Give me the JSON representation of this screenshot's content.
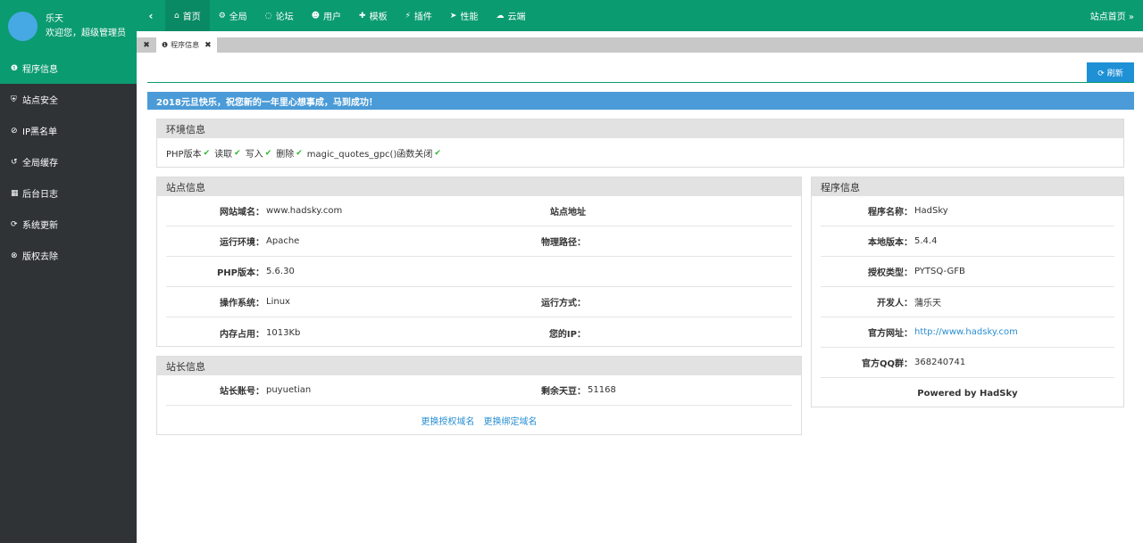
{
  "user": {
    "name": "乐天",
    "greeting": "欢迎您，超级管理员"
  },
  "sidebar": {
    "items": [
      {
        "icon": "info-circle-icon",
        "glyph": "❶",
        "label": "程序信息"
      },
      {
        "icon": "shield-icon",
        "glyph": "⛨",
        "label": "站点安全"
      },
      {
        "icon": "ban-icon",
        "glyph": "⊘",
        "label": "IP黑名单"
      },
      {
        "icon": "history-icon",
        "glyph": "↺",
        "label": "全局缓存"
      },
      {
        "icon": "calendar-icon",
        "glyph": "▦",
        "label": "后台日志"
      },
      {
        "icon": "refresh-icon",
        "glyph": "⟳",
        "label": "系统更新"
      },
      {
        "icon": "times-circle-icon",
        "glyph": "⊗",
        "label": "版权去除"
      }
    ]
  },
  "topnav": {
    "back_glyph": "‹",
    "items": [
      {
        "icon": "home-icon",
        "glyph": "⌂",
        "label": "首页"
      },
      {
        "icon": "cogs-icon",
        "glyph": "⚙",
        "label": "全局"
      },
      {
        "icon": "comments-icon",
        "glyph": "◌",
        "label": "论坛"
      },
      {
        "icon": "users-icon",
        "glyph": "☻",
        "label": "用户"
      },
      {
        "icon": "puzzle-icon",
        "glyph": "✚",
        "label": "模板"
      },
      {
        "icon": "plug-icon",
        "glyph": "⚡",
        "label": "插件"
      },
      {
        "icon": "send-icon",
        "glyph": "➤",
        "label": "性能"
      },
      {
        "icon": "cloud-icon",
        "glyph": "☁",
        "label": "云端"
      }
    ],
    "right_label": "站点首页 »"
  },
  "tabs": {
    "close_all": "✖",
    "active_tab": {
      "icon": "❶",
      "label": "程序信息",
      "close": "✖"
    }
  },
  "toolbar": {
    "refresh_label": "⟳ 刷新"
  },
  "notice": "2018元旦快乐，祝您新的一年里心想事成，马到成功！",
  "env": {
    "title": "环境信息",
    "items": [
      {
        "label": "PHP版本",
        "check": "✔"
      },
      {
        "label": "读取",
        "check": "✔"
      },
      {
        "label": "写入",
        "check": "✔"
      },
      {
        "label": "删除",
        "check": "✔"
      },
      {
        "label": "magic_quotes_gpc()函数关闭",
        "check": "✔"
      }
    ]
  },
  "site": {
    "title": "站点信息",
    "rows": [
      {
        "l1": "网站域名：",
        "v1": "www.hadsky.com",
        "l2": "站点地址",
        "v2": ""
      },
      {
        "l1": "运行环境：",
        "v1": "Apache",
        "l2": "物理路径：",
        "v2": ""
      },
      {
        "l1": "PHP版本：",
        "v1": "5.6.30",
        "l2": "",
        "v2": ""
      },
      {
        "l1": "操作系统：",
        "v1": "Linux",
        "l2": "运行方式：",
        "v2": ""
      },
      {
        "l1": "内存占用：",
        "v1": "1013Kb",
        "l2": "您的IP：",
        "v2": ""
      }
    ]
  },
  "owner": {
    "title": "站长信息",
    "row": {
      "l1": "站长账号：",
      "v1": "puyuetian",
      "l2": "剩余天豆：",
      "v2": "51168"
    },
    "links": [
      "更换授权域名",
      "更换绑定域名"
    ]
  },
  "program": {
    "title": "程序信息",
    "rows": [
      {
        "label": "程序名称：",
        "value": "HadSky"
      },
      {
        "label": "本地版本：",
        "value": "5.4.4"
      },
      {
        "label": "授权类型：",
        "value": "PYTSQ-GFB"
      },
      {
        "label": "开发人：",
        "value": "蒲乐天"
      },
      {
        "label": "官方网址：",
        "value": "http://www.hadsky.com"
      },
      {
        "label": "官方QQ群：",
        "value": "368240741"
      }
    ],
    "powered": "Powered by HadSky"
  }
}
